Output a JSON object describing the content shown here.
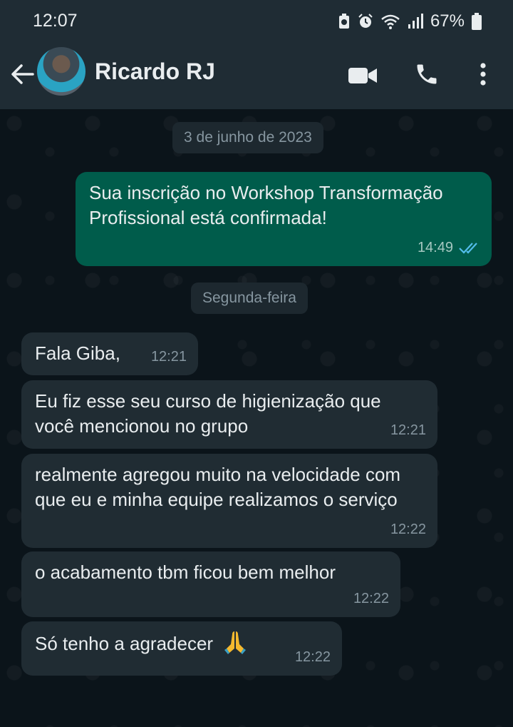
{
  "status_bar": {
    "time": "12:07",
    "battery": "67%"
  },
  "header": {
    "contact_name": "Ricardo RJ",
    "icons": [
      "arrow-left-icon",
      "video-icon",
      "phone-icon",
      "more-vert-icon"
    ]
  },
  "chat": {
    "date_chips": [
      "3 de junho de 2023",
      "Segunda-feira"
    ],
    "messages": [
      {
        "direction": "out",
        "text": "Sua inscrição no Workshop Transformação Profissional está confirmada!",
        "time": "14:49",
        "status": "read"
      },
      {
        "direction": "in",
        "text": "Fala Giba,",
        "time": "12:21"
      },
      {
        "direction": "in",
        "text": "Eu fiz esse seu curso de higienização que você mencionou no grupo",
        "time": "12:21"
      },
      {
        "direction": "in",
        "text": "realmente agregou muito na velocidade com que eu e minha equipe realizamos o serviço",
        "time": "12:22"
      },
      {
        "direction": "in",
        "text": "o acabamento tbm ficou bem melhor",
        "time": "12:22"
      },
      {
        "direction": "in",
        "text": "Só tenho a agradecer",
        "emoji": "folded-hands-icon",
        "time": "12:22"
      }
    ]
  },
  "colors": {
    "header_bg": "#1f2c34",
    "chat_bg": "#0b141a",
    "out_bubble": "#005c4b",
    "in_bubble": "#202c33",
    "read_ticks": "#53bdeb"
  }
}
